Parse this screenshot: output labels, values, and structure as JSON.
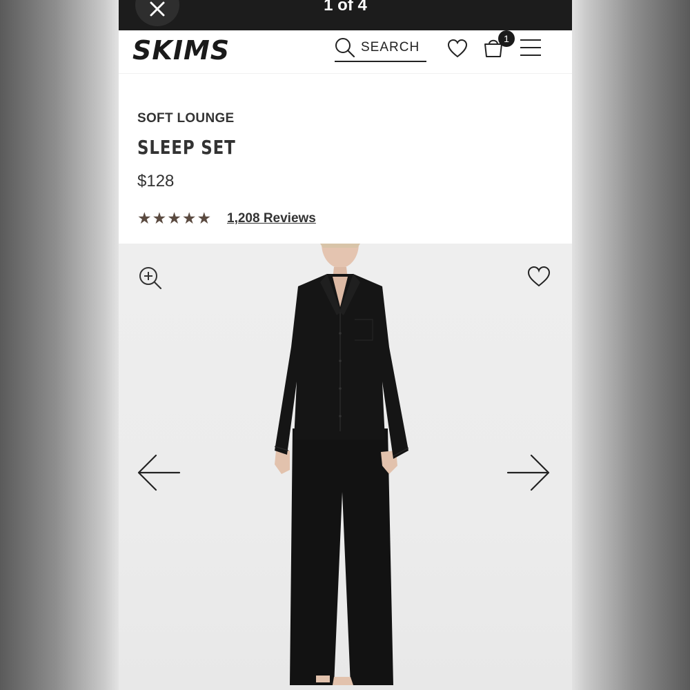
{
  "viewer": {
    "counter": "1 of 4"
  },
  "header": {
    "brand": "SKIMS",
    "search_label": "SEARCH",
    "cart_count": "1"
  },
  "product": {
    "collection": "SOFT LOUNGE",
    "name": "SLEEP SET",
    "price": "$128",
    "rating": 5,
    "reviews_label": "1,208 Reviews"
  },
  "icons": {
    "close": "close-icon",
    "search": "search-icon",
    "wishlist": "heart-icon",
    "cart": "shopping-bag-icon",
    "menu": "hamburger-menu-icon",
    "zoom": "zoom-in-icon",
    "prev": "arrow-left-icon",
    "next": "arrow-right-icon"
  },
  "colors": {
    "topbar": "#1c1c1c",
    "text": "#333333",
    "stars": "#5a4a40",
    "photo_background": "#ececec",
    "garment": "#141414"
  }
}
